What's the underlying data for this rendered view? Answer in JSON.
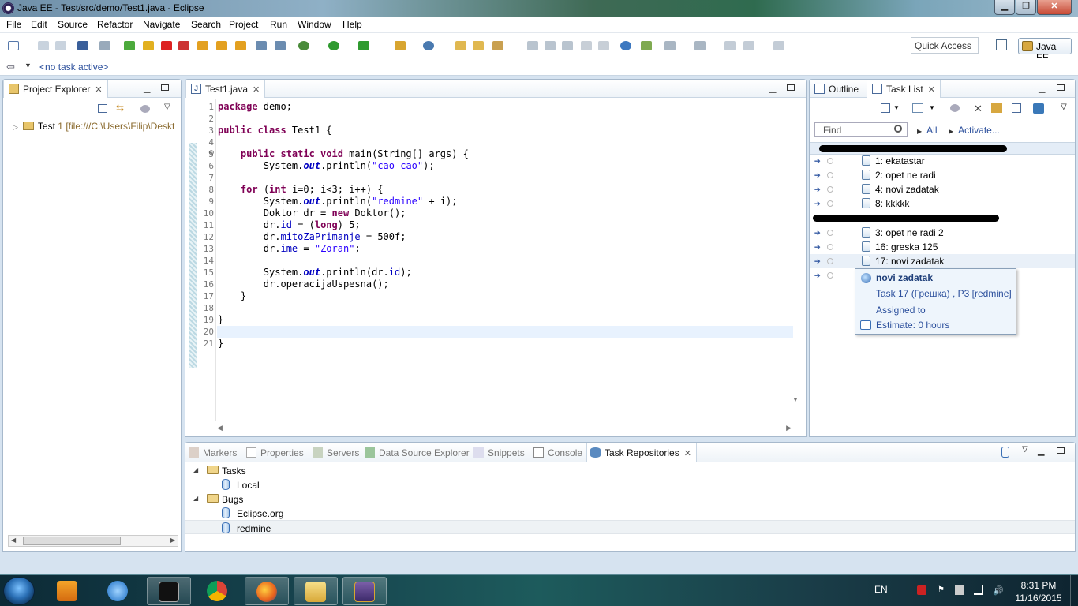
{
  "window": {
    "title": "Java EE - Test/src/demo/Test1.java - Eclipse"
  },
  "menu": [
    "File",
    "Edit",
    "Source",
    "Refactor",
    "Navigate",
    "Search",
    "Project",
    "Run",
    "Window",
    "Help"
  ],
  "toolbar": {
    "quick_access": "Quick Access",
    "perspective": "Java EE"
  },
  "task_bar": {
    "no_task": "<no task active>"
  },
  "project_explorer": {
    "tab": "Project Explorer",
    "project_name": "Test",
    "project_num": "1",
    "project_path": "[file:///C:\\Users\\Filip\\Deskt"
  },
  "editor": {
    "tab": "Test1.java",
    "line_numbers": [
      "1",
      "2",
      "3",
      "4",
      "5",
      "6",
      "7",
      "8",
      "9",
      "10",
      "11",
      "12",
      "13",
      "14",
      "15",
      "16",
      "17",
      "18",
      "19",
      "20",
      "21"
    ],
    "fold_marker": "⊖"
  },
  "outline": {
    "tab": "Outline"
  },
  "task_list": {
    "tab": "Task List",
    "find_placeholder": "Find",
    "filter_all": "All",
    "activate": "Activate...",
    "tasks_group1": [
      "1: ekatastar",
      "2: opet ne radi",
      "4: novi zadatak",
      "8: kkkkk"
    ],
    "tasks_group2": [
      "3: opet ne radi 2",
      "16: greska 125",
      "17: novi zadatak"
    ]
  },
  "tooltip": {
    "title": "novi zadatak",
    "line1": "Task 17 (Грешка) , P3  [redmine]",
    "line2": "Assigned to",
    "line3": "Estimate: 0 hours"
  },
  "bottom_tabs": {
    "markers": "Markers",
    "properties": "Properties",
    "servers": "Servers",
    "data_source": "Data Source Explorer",
    "snippets": "Snippets",
    "console": "Console",
    "task_repositories": "Task Repositories"
  },
  "repositories": {
    "tasks_label": "Tasks",
    "local_label": "Local",
    "bugs_label": "Bugs",
    "eclipse_label": "Eclipse.org",
    "redmine_label": "redmine"
  },
  "system_tray": {
    "language": "EN",
    "time": "8:31 PM",
    "date": "11/16/2015"
  },
  "colors": {
    "keyword": "#7f0055",
    "string": "#2a00ff",
    "field": "#0000c0",
    "link": "#2b4f9c"
  }
}
